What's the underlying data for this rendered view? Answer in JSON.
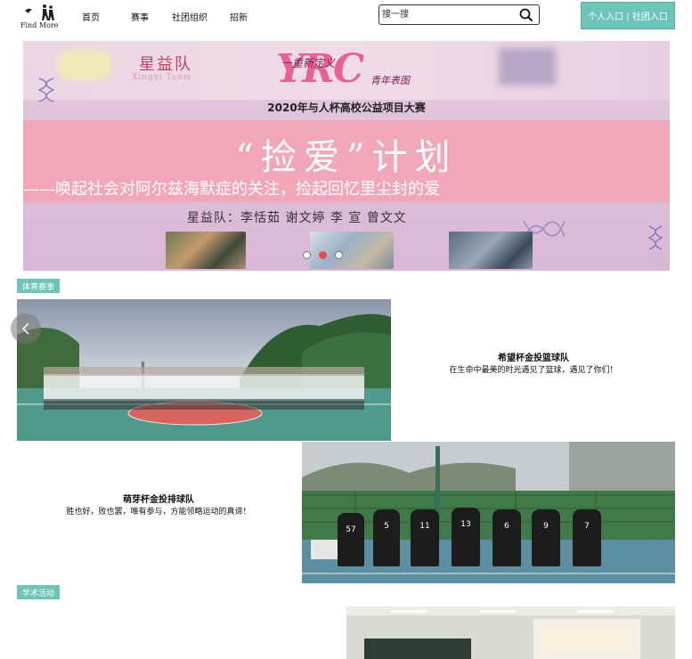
{
  "header": {
    "logo_text": "Find More",
    "nav": [
      "首页",
      "赛事",
      "社团组织",
      "招新"
    ],
    "search_placeholder": "搜一搜",
    "entry_label": "个人入口 | 社团入口"
  },
  "banner": {
    "team_name": "星益队",
    "team_name_en": "Xingyi Team",
    "logo_text": "YRC",
    "slogan_line1": "一重新定义",
    "slogan_line2": "青年表图",
    "contest_title": "2020年与人杯高校公益项目大赛",
    "main_slogan": "“捡爱”计划",
    "sub_slogan": "——唤起社会对阿尔兹海默症的关注，捡起回忆里尘封的爱",
    "members": "星益队：李恬茹  谢文婷  李 宣  曾文文",
    "carousel_dots": 3,
    "carousel_active": 2
  },
  "sections": [
    {
      "tag": "体育赛事",
      "items": [
        {
          "title": "希望杯金投篮球队",
          "desc": "在生命中最美的时光遇见了篮球，遇见了你们！"
        },
        {
          "title": "萌芽杯金投排球队",
          "desc": "胜也好，败也罢，唯有参与，方能领略运动的真谛！"
        }
      ]
    },
    {
      "tag": "学术活动",
      "items": []
    }
  ],
  "jerseys": [
    "57",
    "5",
    "11",
    "13",
    "6",
    "9",
    "7"
  ],
  "colors": {
    "accent": "#6dc5b9",
    "banner_pink": "#f2a7b9",
    "dot_active": "#e84b4b"
  }
}
